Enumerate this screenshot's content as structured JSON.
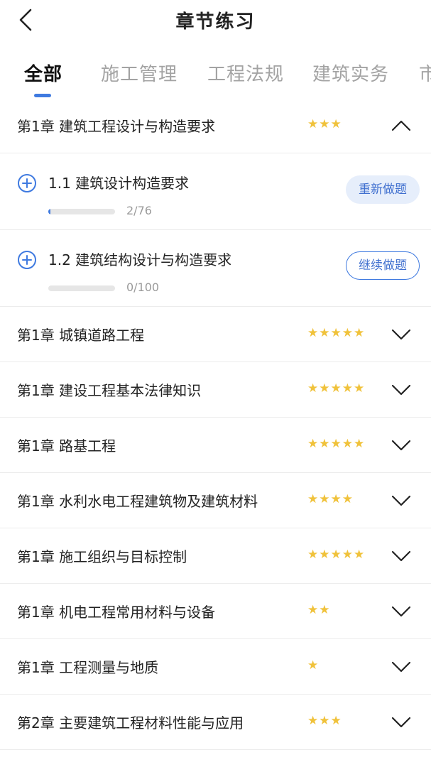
{
  "header": {
    "title": "章节练习"
  },
  "tabs": [
    {
      "label": "全部",
      "active": true
    },
    {
      "label": "施工管理"
    },
    {
      "label": "工程法规"
    },
    {
      "label": "建筑实务"
    },
    {
      "label": "市"
    }
  ],
  "colors": {
    "accent": "#3f7ae0",
    "star": "#f0c23b"
  },
  "chapters": [
    {
      "title": "第1章  建筑工程设计与构造要求",
      "stars": "★★★",
      "expanded": true,
      "sections": [
        {
          "title": "1.1  建筑设计构造要求",
          "progress": "2/76",
          "progress_fraction": 0.026,
          "button": "重新做题"
        },
        {
          "title": "1.2  建筑结构设计与构造要求",
          "progress": "0/100",
          "progress_fraction": 0,
          "button": "继续做题"
        }
      ]
    },
    {
      "title": "第1章  城镇道路工程",
      "stars": "★★★★★"
    },
    {
      "title": "第1章  建设工程基本法律知识",
      "stars": "★★★★★"
    },
    {
      "title": "第1章  路基工程",
      "stars": "★★★★★"
    },
    {
      "title": "第1章  水利水电工程建筑物及建筑材料",
      "stars": "★★★★"
    },
    {
      "title": "第1章 施工组织与目标控制",
      "stars": "★★★★★"
    },
    {
      "title": "第1章  机电工程常用材料与设备",
      "stars": "★★"
    },
    {
      "title": "第1章 工程测量与地质",
      "stars": "★"
    },
    {
      "title": "第2章  主要建筑工程材料性能与应用",
      "stars": "★★★"
    }
  ]
}
